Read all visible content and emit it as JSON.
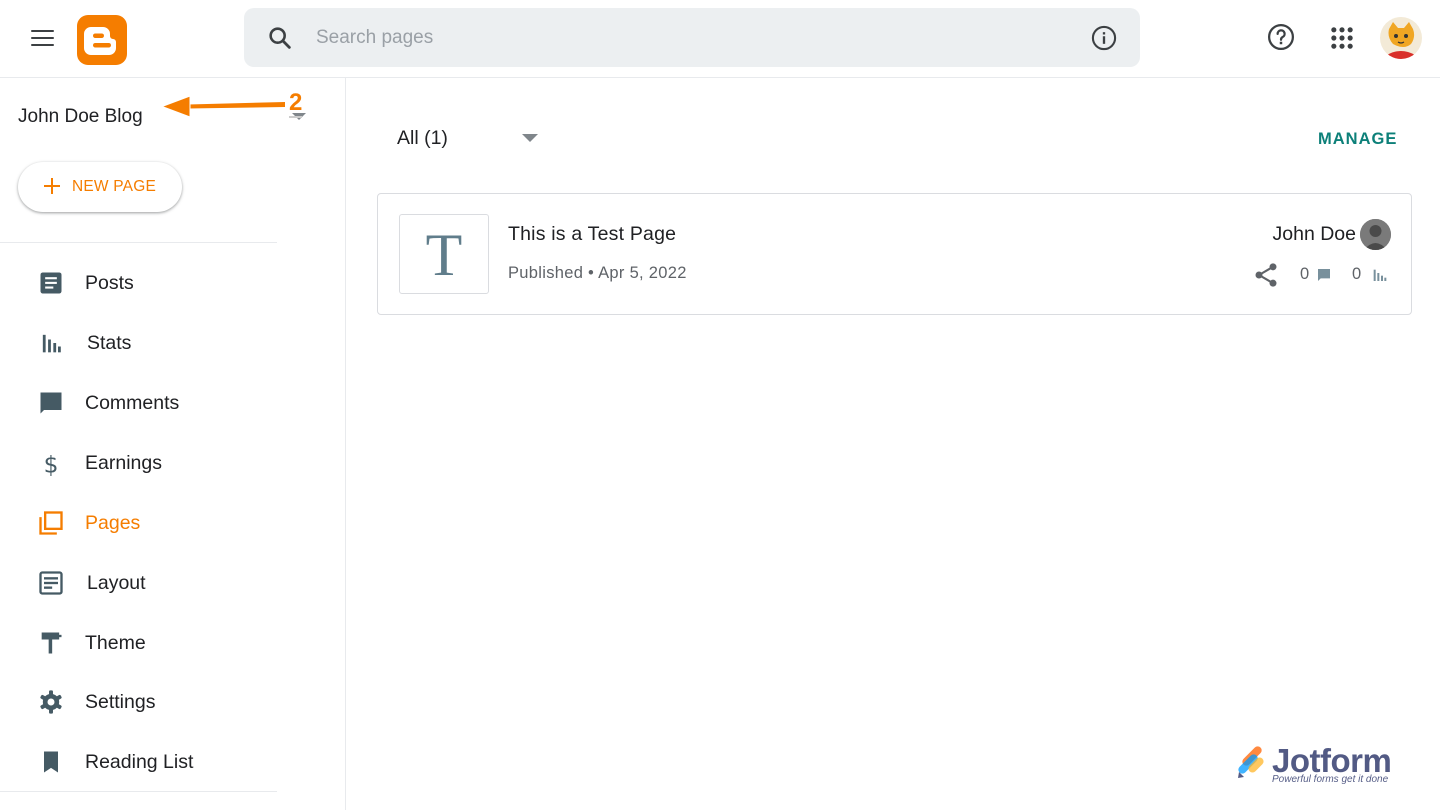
{
  "header": {
    "search_placeholder": "Search pages"
  },
  "sidebar": {
    "blog_name": "John Doe Blog",
    "new_page_label": "NEW PAGE",
    "callout_number": "2",
    "items": [
      {
        "label": "Posts",
        "icon": "posts-icon"
      },
      {
        "label": "Stats",
        "icon": "stats-icon"
      },
      {
        "label": "Comments",
        "icon": "comments-icon"
      },
      {
        "label": "Earnings",
        "icon": "earnings-icon"
      },
      {
        "label": "Pages",
        "icon": "pages-icon",
        "active": true
      },
      {
        "label": "Layout",
        "icon": "layout-icon"
      },
      {
        "label": "Theme",
        "icon": "theme-icon"
      },
      {
        "label": "Settings",
        "icon": "gear-icon"
      },
      {
        "label": "Reading List",
        "icon": "bookmark-icon"
      }
    ]
  },
  "main": {
    "filter_label": "All (1)",
    "manage_label": "MANAGE",
    "pages": [
      {
        "thumb_letter": "T",
        "title": "This is a Test Page",
        "meta": "Published • Apr 5, 2022",
        "author": "John Doe",
        "comments": "0",
        "views": "0"
      }
    ]
  },
  "watermark": {
    "name": "Jotform",
    "tagline": "Powerful forms get it done"
  },
  "colors": {
    "accent": "#f57d00",
    "manage": "#0d8079",
    "icon": "#455a64"
  }
}
